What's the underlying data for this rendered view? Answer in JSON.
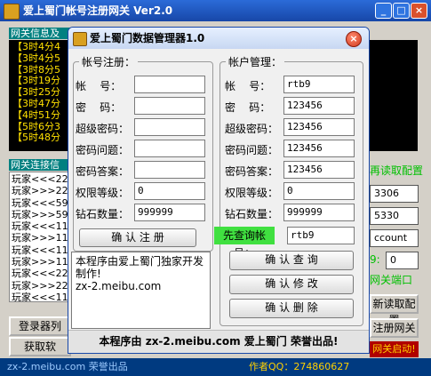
{
  "main": {
    "title": "爱上蜀门帐号注册网关 Ver2.0",
    "min": "_",
    "max": "□",
    "close": "×",
    "log_header": "网关信息及",
    "log_lines": [
      "【3时4分4",
      "【3时4分5",
      "【3时8分5",
      "【3时19分",
      "【3时25分",
      "【3时47分",
      "【4时51分",
      "【5时6分3",
      "【5时48分"
    ],
    "conn_header": "网关连接信",
    "conn_lines": [
      "玩家<<<22",
      "玩家>>>22",
      "玩家<<<59",
      "玩家>>>59",
      "玩家<<<11",
      "玩家>>>11",
      "玩家<<<11",
      "玩家>>>11",
      "玩家<<<22",
      "玩家>>>22",
      "玩家<<<11",
      "玩家>>>11"
    ],
    "btn_login_list": "登录器列",
    "btn_get_soft": "获取软",
    "right_reload_config": "再读取配置",
    "right_field1": "3306",
    "right_field2": "5330",
    "right_field3": "ccount",
    "right_green_label": "9:",
    "right_field4": "0",
    "right_gw_port": "网关端口",
    "right_btn_reload": "新读取配置",
    "right_btn_reg_gw": "注册网关",
    "right_started": "网关启动!",
    "status_left": "zx-2.meibu.com 荣誉出品",
    "status_right": "作者QQ：274860627"
  },
  "dialog": {
    "title": "爱上蜀门数据管理器1.0",
    "close": "×",
    "register": {
      "legend": "帐号注册：",
      "labels": [
        "帐    号：",
        "密    码：",
        "超级密码：",
        "密码问题：",
        "密码答案：",
        "权限等级：",
        "钻石数量："
      ],
      "values": [
        "",
        "",
        "",
        "",
        "",
        "0",
        "999999"
      ],
      "button": "确 认 注 册"
    },
    "manage": {
      "legend": "帐户管理：",
      "labels": [
        "帐    号：",
        "密    码：",
        "超级密码：",
        "密码问题：",
        "密码答案：",
        "权限等级：",
        "钻石数量："
      ],
      "values": [
        "rtb9",
        "123456",
        "123456",
        "123456",
        "123456",
        "0",
        "999999"
      ],
      "lookup_label": "先查询帐号：",
      "lookup_value": "rtb9",
      "btn_query": "确 认 查 询",
      "btn_modify": "确 认 修 改",
      "btn_delete": "确 认 删 除"
    },
    "notice": "本程序由爱上蜀门独家开发制作!\nzx-2.meibu.com",
    "footer": "本程序由 zx-2.meibu.com 爱上蜀门 荣誉出品!"
  }
}
